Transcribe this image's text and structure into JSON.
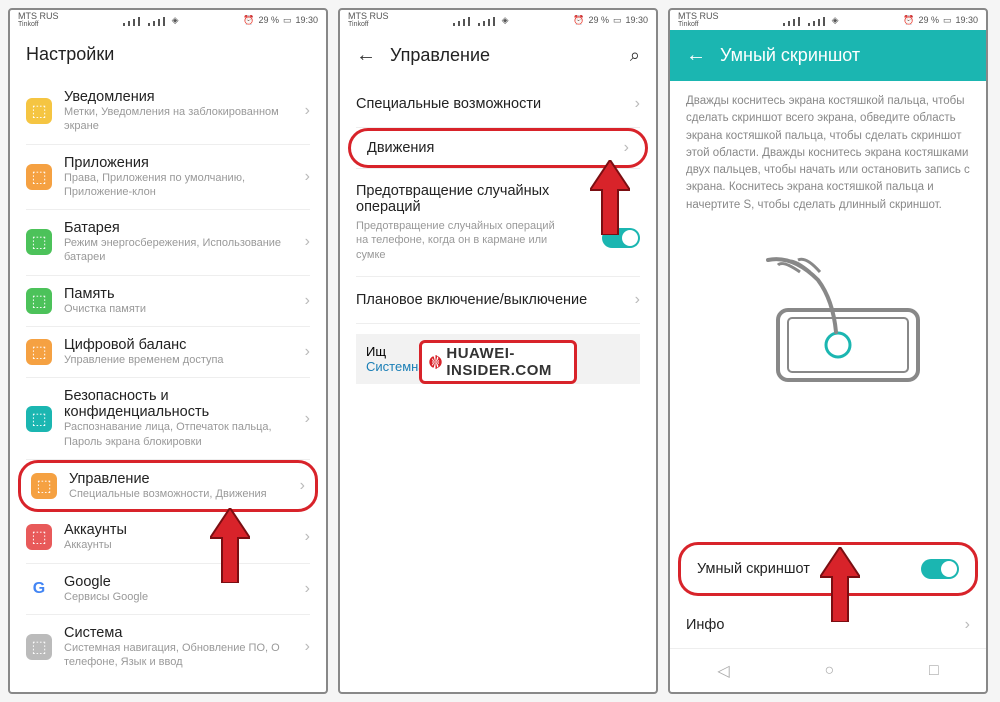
{
  "status": {
    "carrier": "MTS RUS",
    "sub": "Tinkoff",
    "battery": "29 %",
    "time": "19:30"
  },
  "watermark": "HUAWEI-INSIDER.COM",
  "screen1": {
    "title": "Настройки",
    "items": [
      {
        "icon": "#f5c542",
        "title": "Уведомления",
        "sub": "Метки, Уведомления на заблокированном экране"
      },
      {
        "icon": "#f5a142",
        "title": "Приложения",
        "sub": "Права, Приложения по умолчанию, Приложение-клон"
      },
      {
        "icon": "#4cc25a",
        "title": "Батарея",
        "sub": "Режим энергосбережения, Использование батареи"
      },
      {
        "icon": "#4cc25a",
        "title": "Память",
        "sub": "Очистка памяти"
      },
      {
        "icon": "#f5a142",
        "title": "Цифровой баланс",
        "sub": "Управление временем доступа"
      },
      {
        "icon": "#1bb6b1",
        "title": "Безопасность и конфиденциальность",
        "sub": "Распознавание лица, Отпечаток пальца, Пароль экрана блокировки"
      },
      {
        "icon": "#f5a142",
        "title": "Управление",
        "sub": "Специальные возможности, Движения",
        "highlight": true
      },
      {
        "icon": "#e85a5a",
        "title": "Аккаунты",
        "sub": "Аккаунты"
      },
      {
        "icon": "#fff",
        "title": "Google",
        "sub": "Сервисы Google",
        "gicon": true
      },
      {
        "icon": "#bbb",
        "title": "Система",
        "sub": "Системная навигация, Обновление ПО, О телефоне, Язык и ввод"
      }
    ]
  },
  "screen2": {
    "title": "Управление",
    "items": [
      {
        "title": "Специальные возможности"
      },
      {
        "title": "Движения",
        "highlight": true
      },
      {
        "title": "Предотвращение случайных операций",
        "sub": "Предотвращение случайных операций на телефоне, когда он в кармане или сумке",
        "toggle": true
      },
      {
        "title": "Плановое включение/выключение"
      }
    ],
    "search_label": "Ищ",
    "nav_hint": "Системная навигация"
  },
  "screen3": {
    "title": "Умный скриншот",
    "desc": "Дважды коснитесь экрана костяшкой пальца, чтобы сделать скриншот всего экрана, обведите область экрана костяшкой пальца, чтобы сделать скриншот этой области. Дважды коснитесь экрана костяшками двух пальцев, чтобы начать или остановить запись с экрана. Коснитесь экрана костяшкой пальца и начертите S, чтобы сделать длинный скриншот.",
    "toggle_label": "Умный скриншот",
    "info_label": "Инфо"
  }
}
